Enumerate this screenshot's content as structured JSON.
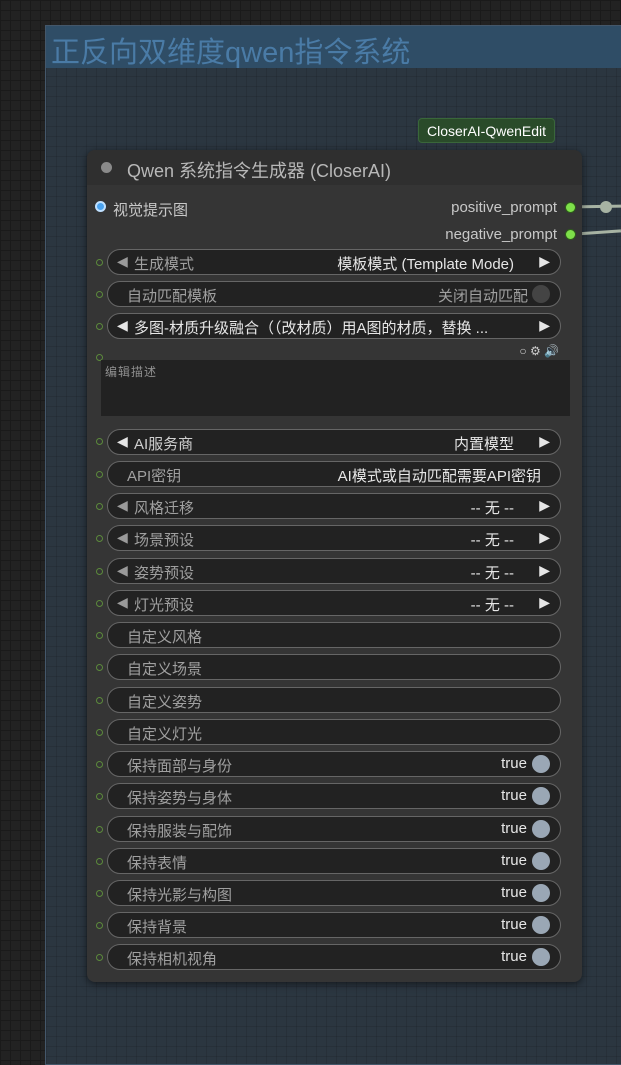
{
  "group": {
    "title": "正反向双维度qwen指令系统"
  },
  "badge": {
    "label": "CloserAI-QwenEdit"
  },
  "node": {
    "title": "Qwen 系统指令生成器 (CloserAI)",
    "inputs": [
      {
        "label": "视觉提示图"
      }
    ],
    "outputs": [
      {
        "label": "positive_prompt"
      },
      {
        "label": "negative_prompt"
      }
    ],
    "widgets": {
      "mode": {
        "label": "生成模式",
        "value": "模板模式 (Template Mode)"
      },
      "auto_match": {
        "label": "自动匹配模板",
        "value": "关闭自动匹配"
      },
      "template": {
        "value": "多图-材质升级融合（（改材质）用A图的材质，替换 ..."
      },
      "edit_desc": {
        "placeholder": "编辑描述"
      },
      "ai_provider": {
        "label": "AI服务商",
        "value": "内置模型"
      },
      "api_key": {
        "label": "API密钥",
        "value": "AI模式或自动匹配需要API密钥"
      },
      "style": {
        "label": "风格迁移",
        "value": "-- 无 --"
      },
      "scene": {
        "label": "场景预设",
        "value": "-- 无 --"
      },
      "pose": {
        "label": "姿势预设",
        "value": "-- 无 --"
      },
      "light": {
        "label": "灯光预设",
        "value": "-- 无 --"
      },
      "custom_style": {
        "label": "自定义风格"
      },
      "custom_scene": {
        "label": "自定义场景"
      },
      "custom_pose": {
        "label": "自定义姿势"
      },
      "custom_light": {
        "label": "自定义灯光"
      },
      "toggles": [
        {
          "label": "保持面部与身份",
          "value": "true"
        },
        {
          "label": "保持姿势与身体",
          "value": "true"
        },
        {
          "label": "保持服装与配饰",
          "value": "true"
        },
        {
          "label": "保持表情",
          "value": "true"
        },
        {
          "label": "保持光影与构图",
          "value": "true"
        },
        {
          "label": "保持背景",
          "value": "true"
        },
        {
          "label": "保持相机视角",
          "value": "true"
        }
      ]
    },
    "textarea_icons": "○ ⚙ 🔊"
  },
  "colors": {
    "group_bg": "#2b3640",
    "group_header": "#2f4d66",
    "group_title": "#4a7ba6",
    "node_bg": "#353535",
    "badge_bg": "#2a4b2a",
    "output_slot": "#7ee04a",
    "input_slot": "#4aa3f0",
    "toggle_on": "#9aa7b5"
  }
}
